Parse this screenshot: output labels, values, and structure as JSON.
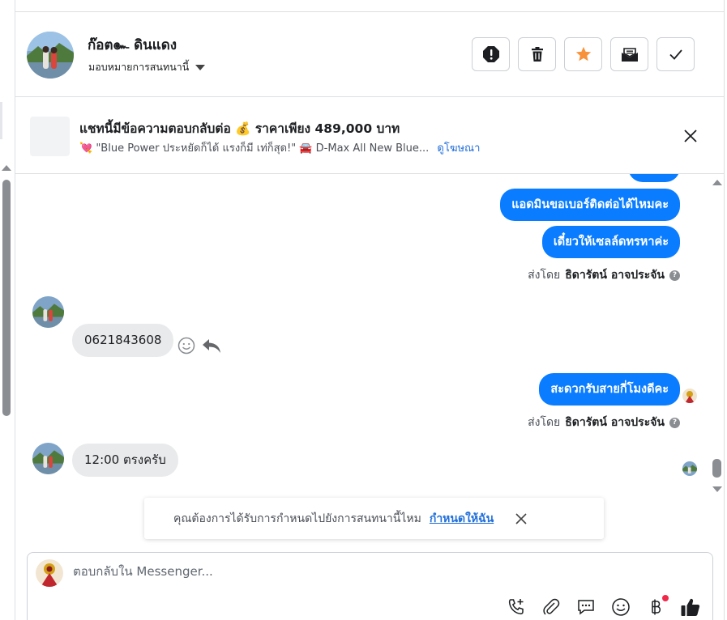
{
  "contact": {
    "name": "ก๊อต๛ ดินแดง",
    "assign_label": "มอบหมายการสนทนานี้"
  },
  "toolbar": [
    "spam-button",
    "delete-button",
    "star-button",
    "mark-unread-button",
    "done-button"
  ],
  "ad": {
    "title": "แชทนี้มีข้อความตอบกลับต่อ 💰 ราคาเพียง 489,000 บาท",
    "subtitle": "💘 \"Blue Power ประหยัดก็ได้ แรงก็มี เท่ก็สุด!\" 🚘 D-Max All New Blue...",
    "link": "ดูโฆษณา"
  },
  "messages": {
    "out1": "แอดมินขอเบอร์ติดต่อได้ไหมคะ",
    "out2": "เดี๋ยวให้เซลล์ดทรหาค่ะ",
    "sent_by_prefix": "ส่งโดย",
    "sent_by_name": "ธิดารัตน์ อาจประจัน",
    "in1": "0621843608",
    "out3": "สะดวกรับสายกี่โมงดีคะ",
    "in2": "12:00 ตรงครับ"
  },
  "toast": {
    "text": "คุณต้องการได้รับการกำหนดไปยังการสนทนานี้ไหม",
    "link": "กำหนดให้ฉัน"
  },
  "composer": {
    "placeholder": "ตอบกลับใน Messenger..."
  },
  "colors": {
    "accent": "#0a7cff",
    "star": "#f7923b",
    "link": "#216fdb"
  }
}
